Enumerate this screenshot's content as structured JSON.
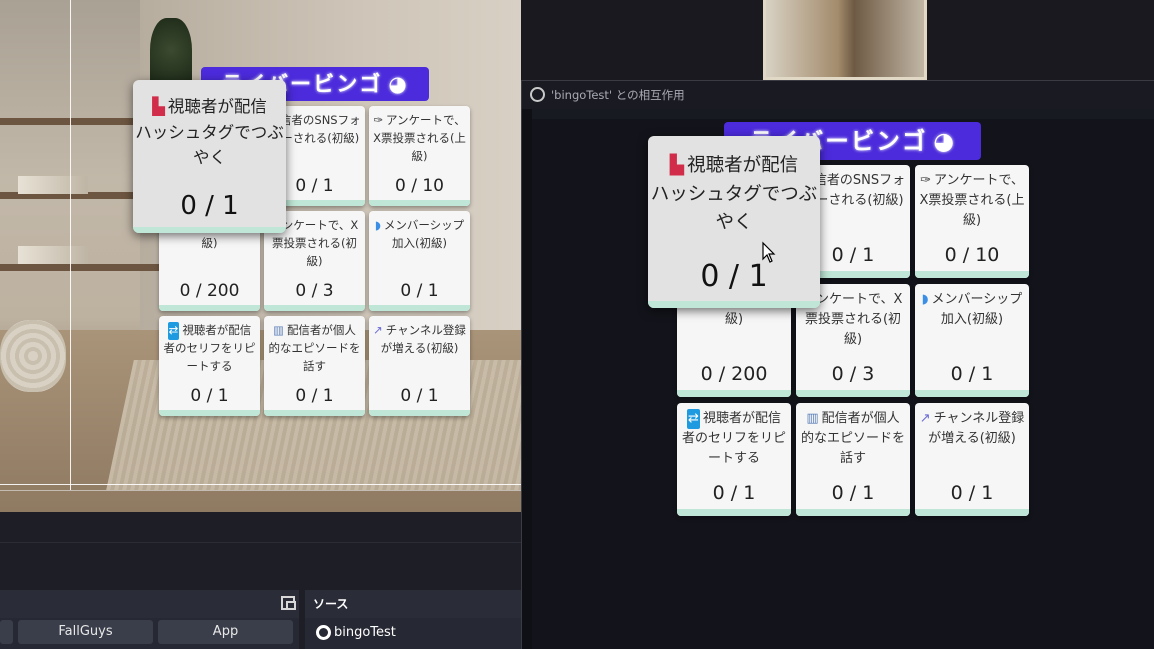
{
  "bingo": {
    "title": "ライバービンゴ",
    "title_icon": "palette-icon",
    "cells": [
      {
        "icon": "",
        "label": "",
        "count": ""
      },
      {
        "icon": "",
        "label": "配信者のSNSフォローされる(初級)",
        "count": "0 / 1"
      },
      {
        "icon": "ballot-icon",
        "label": "アンケートで、X票投票される(上級)",
        "count": "0 / 10"
      },
      {
        "icon": "money-bag-icon",
        "label": "ギフト金額(中級)",
        "count": "0 / 200"
      },
      {
        "icon": "",
        "label": "アンケートで、X票投票される(初級)",
        "count": "0 / 3"
      },
      {
        "icon": "shield-icon",
        "label": "メンバーシップ加入(初級)",
        "count": "0 / 1"
      },
      {
        "icon": "repeat-icon",
        "label": "視聴者が配信者のセリフをリピートする",
        "count": "0 / 1"
      },
      {
        "icon": "book-icon",
        "label": "配信者が個人的なエピソードを話す",
        "count": "0 / 1"
      },
      {
        "icon": "chart-up-icon",
        "label": "チャンネル登録が増える(初級)",
        "count": "0 / 1"
      }
    ],
    "popup": {
      "icon": "boot-icon",
      "line1": "視聴者が配信",
      "line2": "ハッシュタグでつぶやく",
      "count": "0 / 1"
    }
  },
  "obs": {
    "dock_buttons": [
      "FallGuys",
      "App"
    ],
    "sources_header": "ソース",
    "source_items": [
      "bingoTest"
    ],
    "interaction_window_title": "'bingoTest' との相互作用"
  }
}
